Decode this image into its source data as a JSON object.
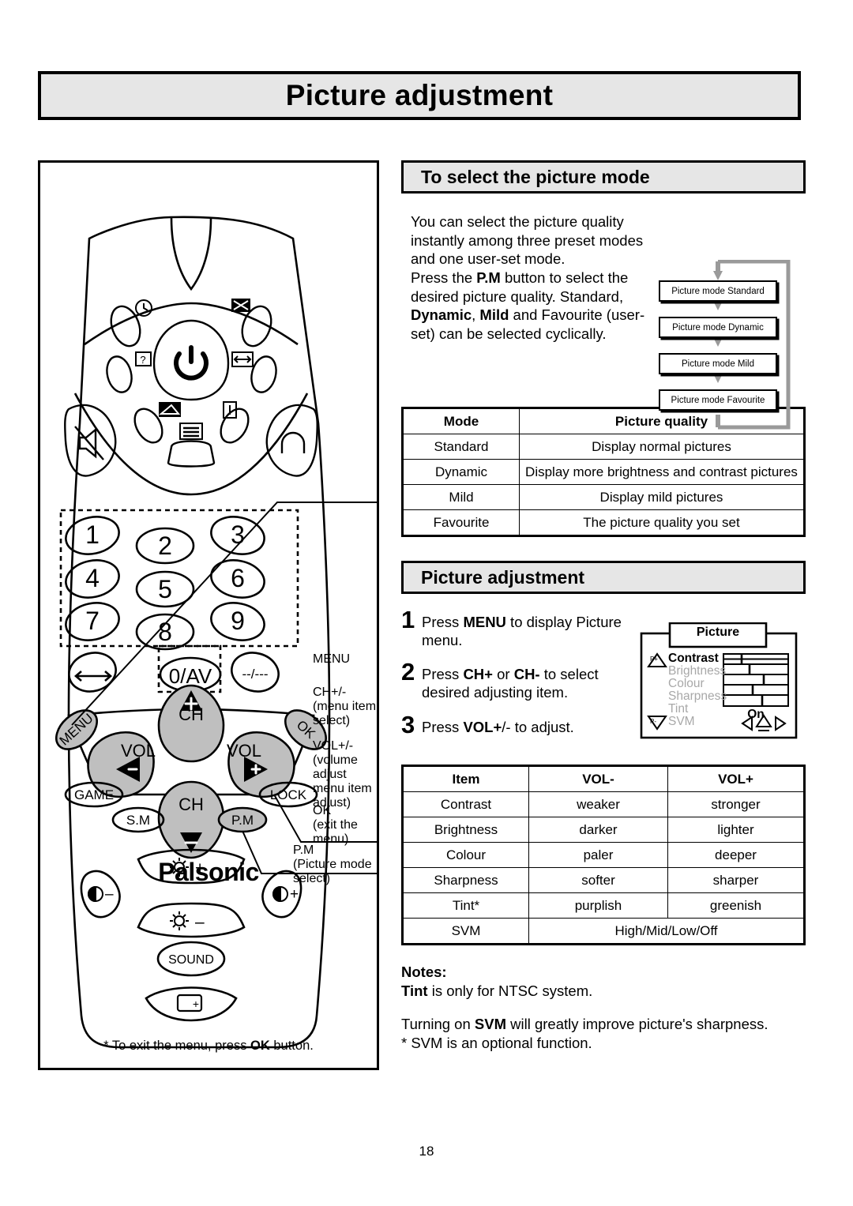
{
  "page": {
    "title": "Picture adjustment",
    "number": "18"
  },
  "left_panel": {
    "remote": {
      "brand": "Palsonic",
      "numeric_keys": [
        "1",
        "2",
        "3",
        "4",
        "5",
        "6",
        "7",
        "8",
        "9"
      ],
      "zero_key": "0/AV",
      "dash_key": "--/---",
      "menu_key": "MENU",
      "ok_key": "OK",
      "ch_up_key": "CH",
      "ch_down_key": "CH",
      "vol_left_key": "VOL",
      "vol_right_key": "VOL",
      "game_key": "GAME",
      "lock_key": "LOCK",
      "sm_key": "S.M",
      "pm_key": "P.M",
      "sound_key": "SOUND",
      "icon_keys": [
        "timer-icon",
        "mute-icon",
        "help-icon",
        "power-icon",
        "swap-icon",
        "wide-icon",
        "picture-icon",
        "headphone-icon",
        "info-icon",
        "text-icon"
      ]
    },
    "callouts": {
      "menu": "MENU",
      "ch": "CH+/-\n(menu item\nselect)",
      "vol": "VOL+/-\n(volume adjust\nmenu item adjust)",
      "ok": "OK\n(exit the menu)",
      "pm": "P.M\n(Picture mode select)"
    },
    "exit_note_prefix": "* To exit the menu, press ",
    "exit_note_bold": "OK",
    "exit_note_suffix": " button."
  },
  "select_mode_section": {
    "heading": "To select the picture mode",
    "paragraph1": "You can select the picture quality instantly among three preset modes and one user-set mode.",
    "paragraph2_parts": [
      {
        "text": "Press the ",
        "bold": false
      },
      {
        "text": "P.M",
        "bold": true
      },
      {
        "text": " button to select the desired picture quality. Standard, ",
        "bold": false
      },
      {
        "text": "Dynamic",
        "bold": true
      },
      {
        "text": ", ",
        "bold": false
      },
      {
        "text": "Mild",
        "bold": true
      },
      {
        "text": " and Favourite (user-set) can be selected cyclically.",
        "bold": false
      }
    ],
    "flow_boxes": [
      "Picture mode Standard",
      "Picture mode  Dynamic",
      "Picture mode   Mild",
      "Picture mode Favourite"
    ],
    "mode_table": {
      "headers": [
        "Mode",
        "Picture quality"
      ],
      "rows": [
        [
          "Standard",
          "Display normal pictures"
        ],
        [
          "Dynamic",
          "Display more brightness and contrast pictures"
        ],
        [
          "Mild",
          "Display mild pictures"
        ],
        [
          "Favourite",
          "The picture quality you set"
        ]
      ]
    }
  },
  "adjust_section": {
    "heading": "Picture adjustment",
    "steps": [
      {
        "num": "1",
        "parts": [
          {
            "text": "Press ",
            "bold": false
          },
          {
            "text": "MENU",
            "bold": true
          },
          {
            "text": " to display Picture menu.",
            "bold": false
          }
        ]
      },
      {
        "num": "2",
        "parts": [
          {
            "text": "Press ",
            "bold": false
          },
          {
            "text": "CH+",
            "bold": true
          },
          {
            "text": " or ",
            "bold": false
          },
          {
            "text": "CH-",
            "bold": true
          },
          {
            "text": " to select desired adjusting item.",
            "bold": false
          }
        ]
      },
      {
        "num": "3",
        "parts": [
          {
            "text": "Press ",
            "bold": false
          },
          {
            "text": "VOL+",
            "bold": true
          },
          {
            "text": "/- to adjust.",
            "bold": false
          }
        ]
      }
    ],
    "osd": {
      "title": "Picture",
      "items": [
        "Contrast",
        "Brightness",
        "Colour",
        "Sharpness",
        "Tint",
        "SVM"
      ],
      "svm_value": "On",
      "slider_positions": [
        0.28,
        0.42,
        0.62,
        0.45,
        0.6
      ],
      "up_label": "P+",
      "down_label": "P-"
    },
    "vol_table": {
      "headers": [
        "Item",
        "VOL-",
        "VOL+"
      ],
      "rows": [
        [
          "Contrast",
          "weaker",
          "stronger"
        ],
        [
          "Brightness",
          "darker",
          "lighter"
        ],
        [
          "Colour",
          "paler",
          "deeper"
        ],
        [
          "Sharpness",
          "softer",
          "sharper"
        ],
        [
          "Tint*",
          "purplish",
          "greenish"
        ]
      ],
      "svm_row": {
        "label": "SVM",
        "value": "High/Mid/Low/Off"
      }
    },
    "notes": {
      "title": "Notes:",
      "line1_parts": [
        {
          "text": "Tint",
          "bold": true
        },
        {
          "text": " is only for NTSC system.",
          "bold": false
        }
      ],
      "line2_parts": [
        {
          "text": "Turning on ",
          "bold": false
        },
        {
          "text": "SVM",
          "bold": true
        },
        {
          "text": " will greatly improve picture's sharpness.",
          "bold": false
        }
      ],
      "line3": "* SVM is an optional function."
    }
  },
  "colors": {
    "header_fill": "#e6e6e6",
    "key_fill": "#bfbfbf",
    "line": "#000000",
    "flow_arrow": "#9a9a9a"
  }
}
